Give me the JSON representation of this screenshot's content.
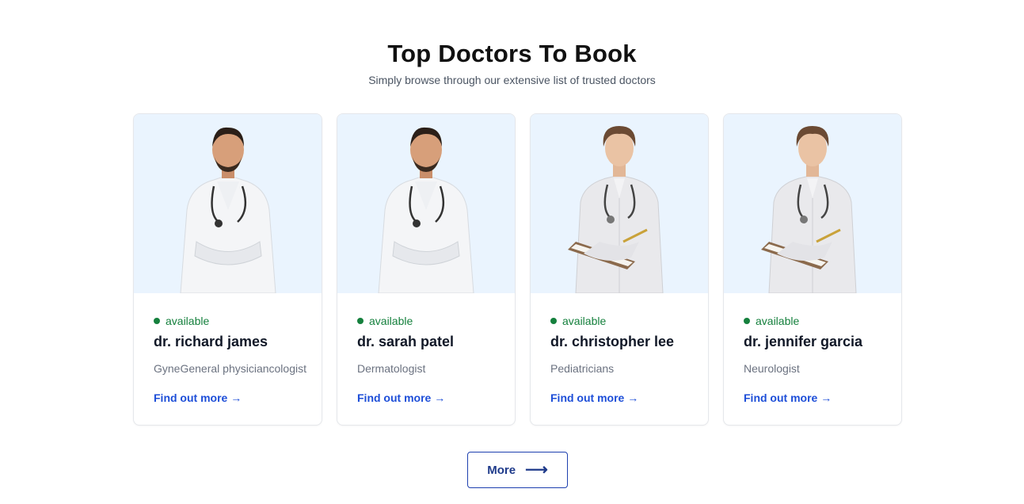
{
  "header": {
    "title": "Top Doctors To Book",
    "subtitle": "Simply browse through our extensive list of trusted doctors"
  },
  "doctors": [
    {
      "status": "available",
      "name": "dr. richard james",
      "specialty": "GyneGeneral physiciancologist",
      "link": "Find out more →"
    },
    {
      "status": "available",
      "name": "dr. sarah patel",
      "specialty": "Dermatologist",
      "link": "Find out more →"
    },
    {
      "status": "available",
      "name": "dr. christopher lee",
      "specialty": "Pediatricians",
      "link": "Find out more →"
    },
    {
      "status": "available",
      "name": "dr. jennifer garcia",
      "specialty": "Neurologist",
      "link": "Find out more →"
    }
  ],
  "more_button": {
    "label": "More",
    "icon": "arrow-right-icon"
  },
  "colors": {
    "photo_bg": "#eaf4fe",
    "available": "#15803d",
    "link": "#1d4ed8",
    "button_border": "#1e40af"
  }
}
